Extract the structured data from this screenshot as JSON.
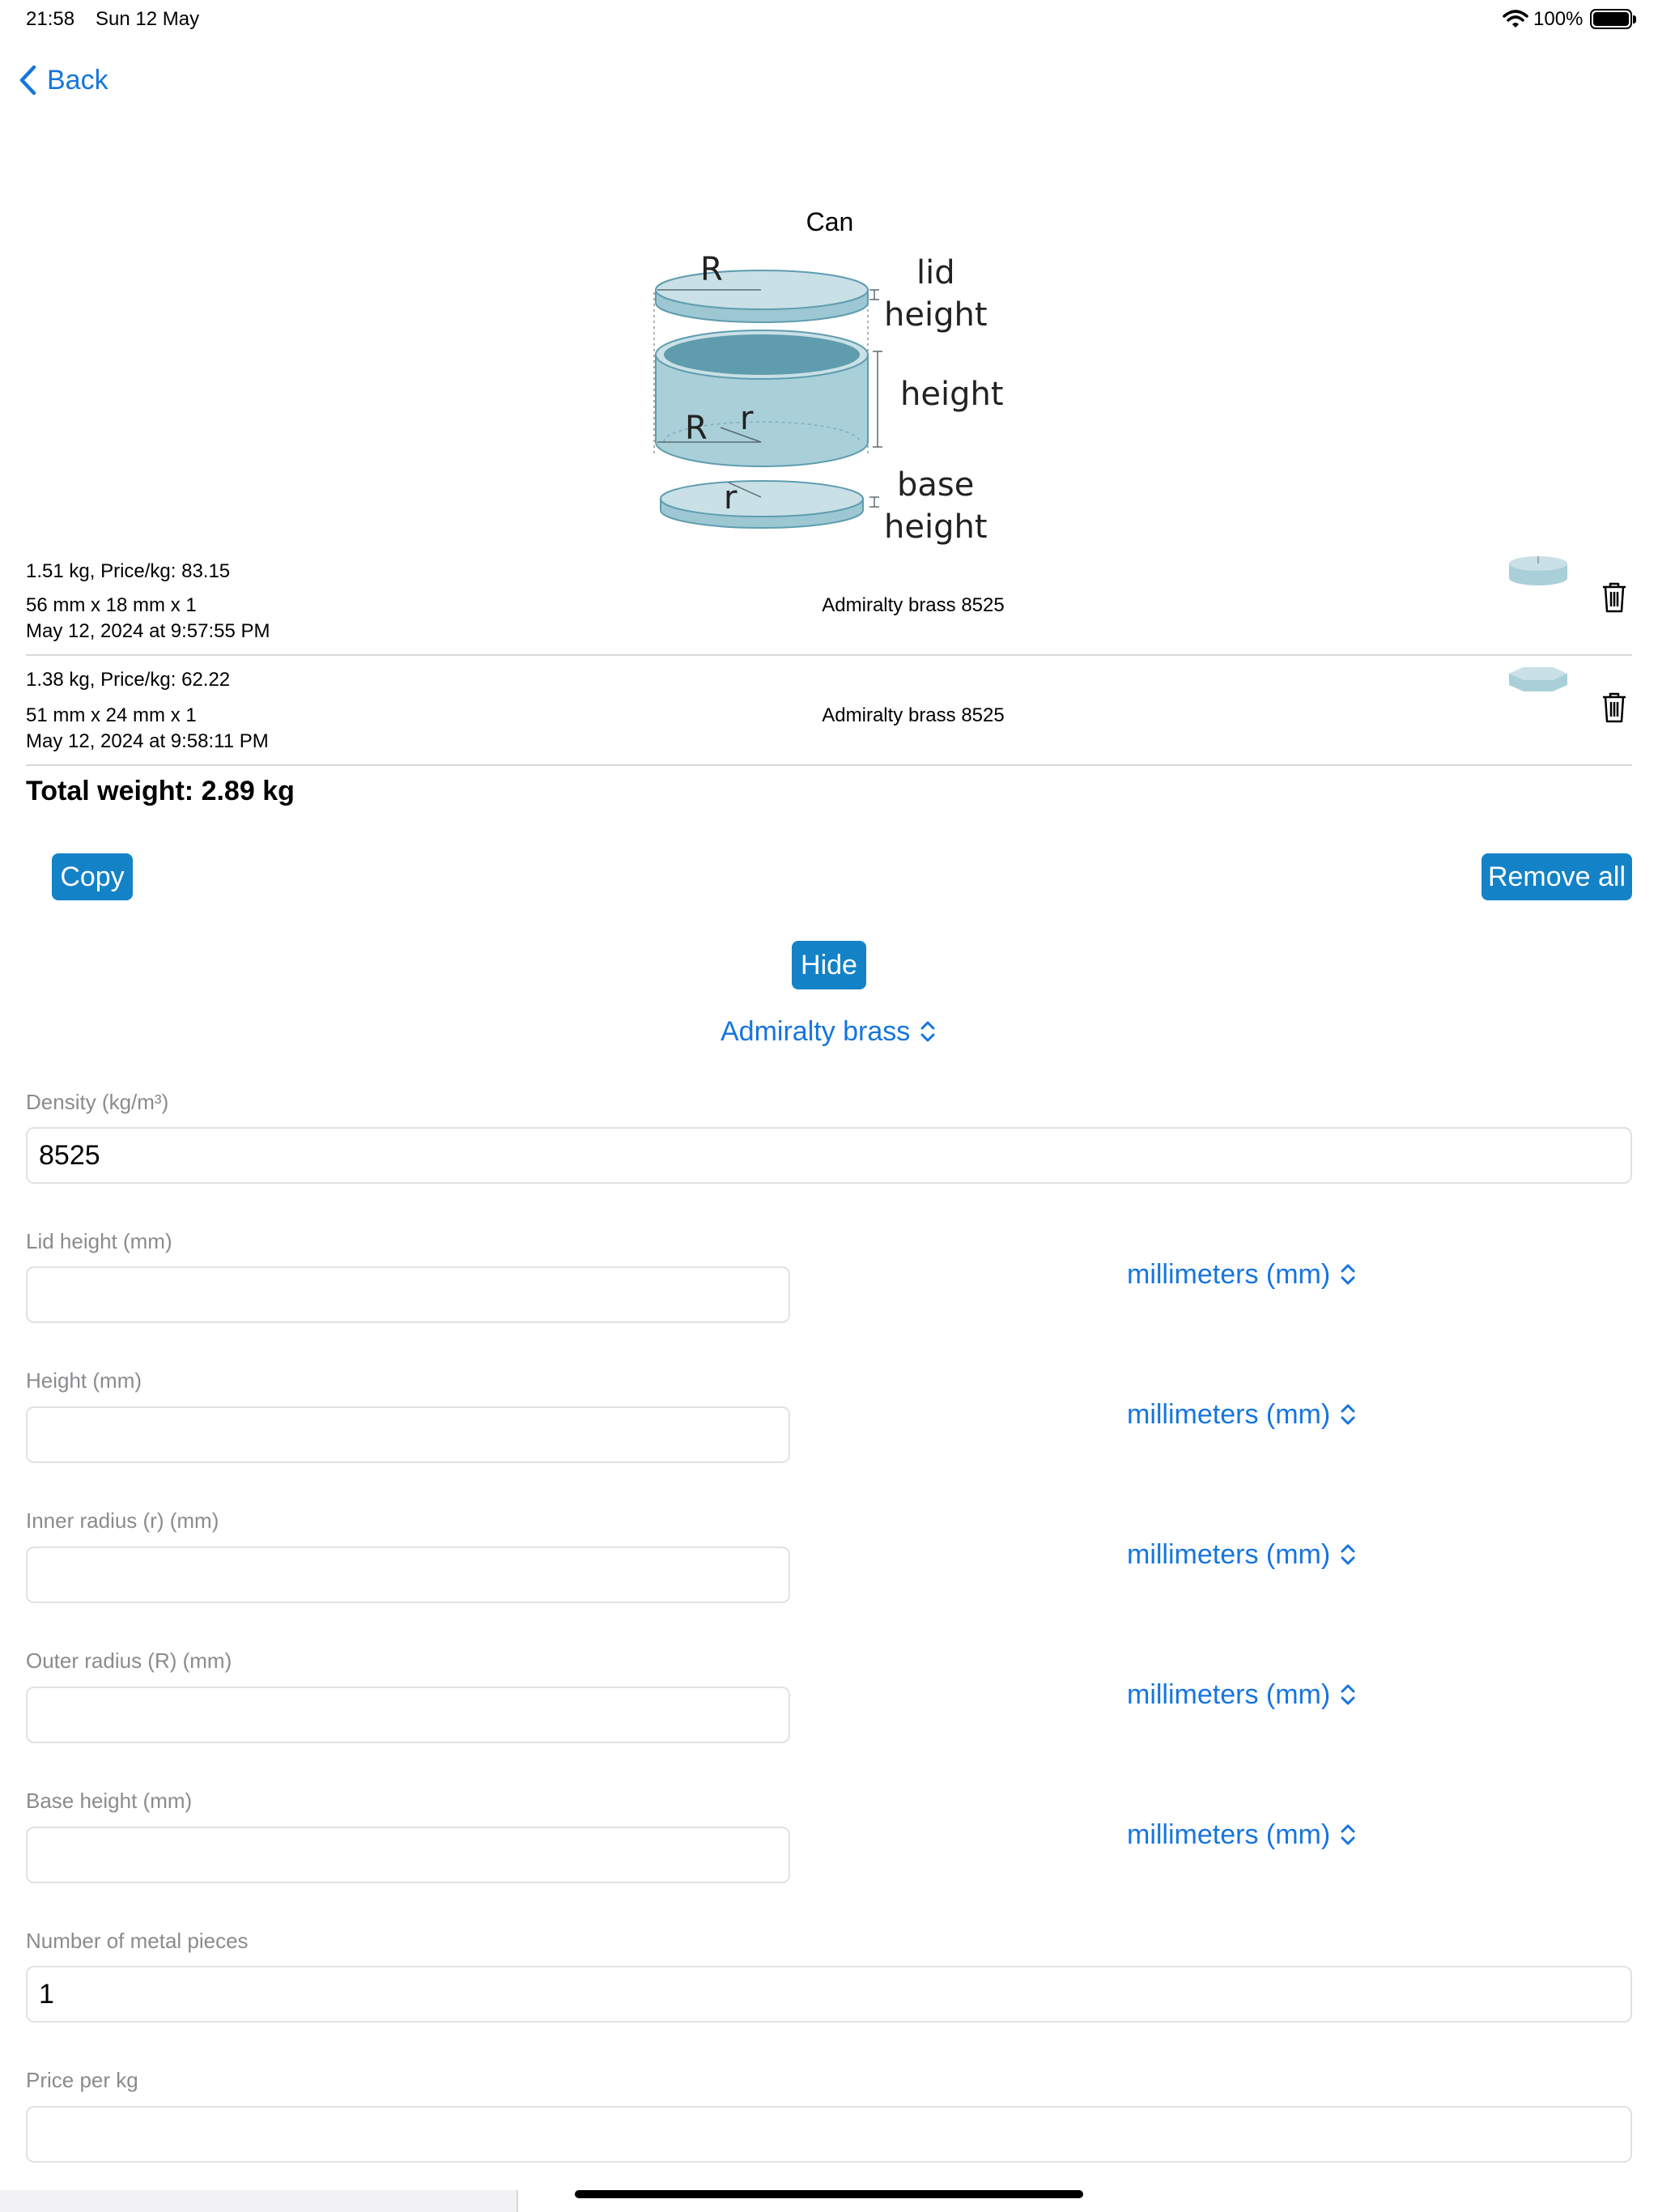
{
  "status_bar": {
    "time": "21:58",
    "date": "Sun 12 May",
    "battery": "100%"
  },
  "nav": {
    "back_label": "Back"
  },
  "diagram": {
    "title": "Can",
    "labels": {
      "outer_r_top": "R",
      "lid_height_line1": "lid",
      "lid_height_line2": "height",
      "height": "height",
      "outer_r_mid": "R",
      "inner_r_mid": "r",
      "inner_r_bottom": "r",
      "base_height_line1": "base",
      "base_height_line2": "height"
    }
  },
  "history": [
    {
      "summary": "1.51 kg, Price/kg: 83.15",
      "dimensions": "56 mm x 18 mm x 1",
      "timestamp": "May 12, 2024 at 9:57:55 PM",
      "material": "Admiralty brass 8525",
      "thumb_icon": "cylinder-thumbnail-icon"
    },
    {
      "summary": "1.38 kg, Price/kg: 62.22",
      "dimensions": "51 mm x 24 mm x 1",
      "timestamp": "May 12, 2024 at 9:58:11 PM",
      "material": "Admiralty brass 8525",
      "thumb_icon": "hexagon-prism-thumbnail-icon"
    }
  ],
  "total_weight": "Total weight: 2.89 kg",
  "buttons": {
    "copy": "Copy",
    "remove_all": "Remove all",
    "hide": "Hide"
  },
  "material_picker": {
    "selected": "Admiralty brass"
  },
  "form": {
    "density": {
      "label": "Density (kg/m³)",
      "value": "8525"
    },
    "lid_height": {
      "label": "Lid height (mm)",
      "value": "",
      "unit": "millimeters (mm)"
    },
    "height": {
      "label": "Height (mm)",
      "value": "",
      "unit": "millimeters (mm)"
    },
    "inner_radius": {
      "label": "Inner radius (r) (mm)",
      "value": "",
      "unit": "millimeters (mm)"
    },
    "outer_radius": {
      "label": "Outer radius (R) (mm)",
      "value": "",
      "unit": "millimeters (mm)"
    },
    "base_height": {
      "label": "Base height (mm)",
      "value": "",
      "unit": "millimeters (mm)"
    },
    "pieces": {
      "label": "Number of metal pieces",
      "value": "1"
    },
    "price": {
      "label": "Price per kg",
      "value": ""
    }
  },
  "colors": {
    "accent": "#1675dd",
    "button": "#1482c7",
    "diagram_fill": "#c9e0e7",
    "diagram_dark": "#5f9dae"
  },
  "icons": {
    "back": "chevron-left-icon",
    "trash": "trash-icon",
    "updown": "chevron-up-down-icon",
    "wifi": "wifi-icon",
    "battery": "battery-icon"
  }
}
